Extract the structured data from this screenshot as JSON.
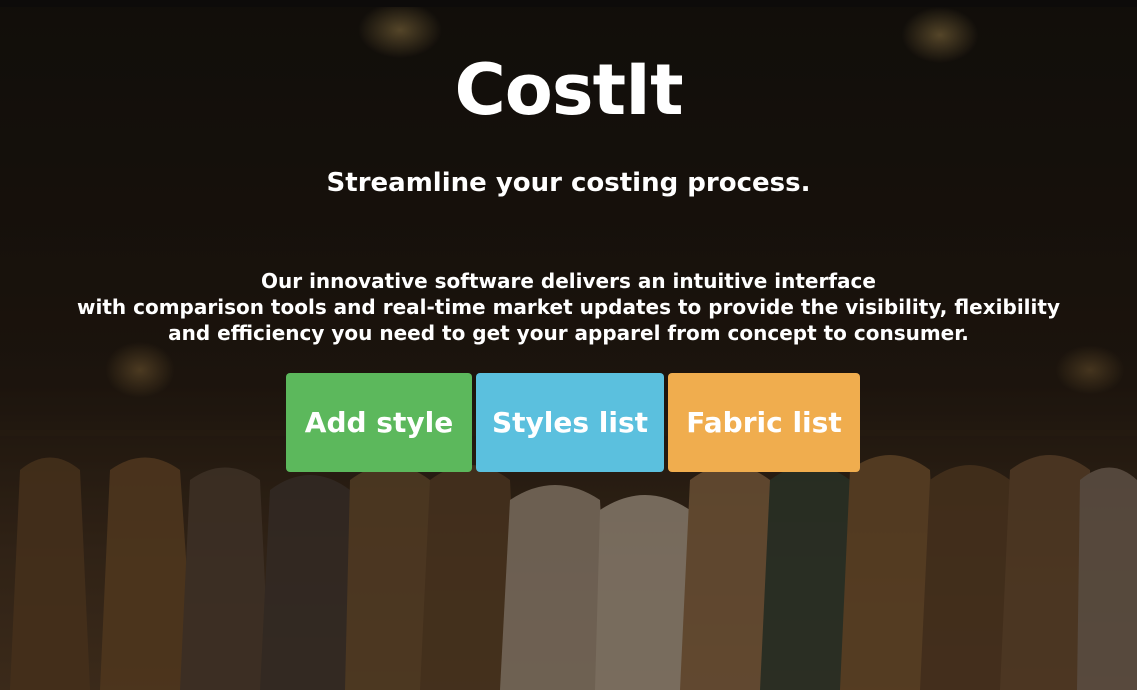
{
  "hero": {
    "title": "CostIt",
    "subtitle": "Streamline your costing process.",
    "description_lines": [
      "Our innovative software delivers an intuitive interface",
      "with comparison tools and real-time market updates to provide the visibility, flexibility",
      "and efficiency you need to get your apparel from concept to consumer."
    ],
    "background": "clothes-rack-photo"
  },
  "actions": {
    "add_style": "Add style",
    "styles_list": "Styles list",
    "fabric_list": "Fabric list"
  },
  "colors": {
    "add_style": "#5cb85c",
    "styles_list": "#5bc0de",
    "fabric_list": "#f0ad4e"
  }
}
